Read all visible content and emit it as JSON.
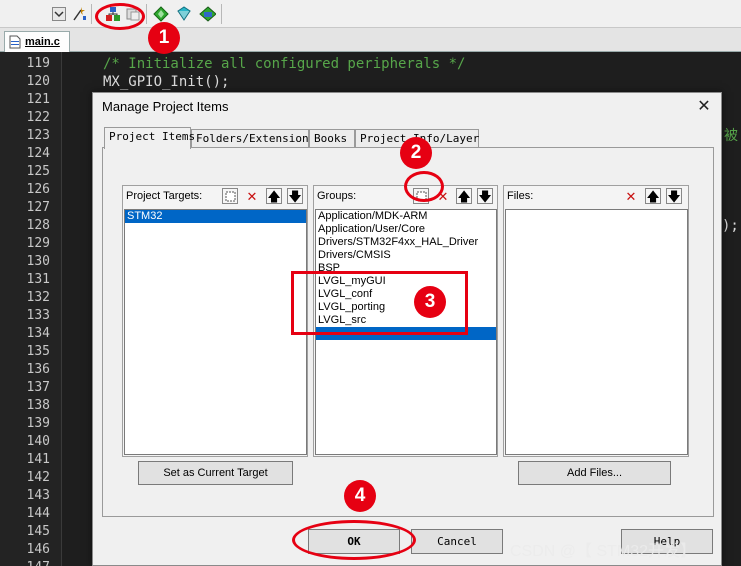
{
  "editor": {
    "tab_label": "main.c",
    "line_numbers": [
      "119",
      "120",
      "121",
      "122",
      "123",
      "124",
      "125",
      "126",
      "127",
      "128",
      "129",
      "130",
      "131",
      "132",
      "133",
      "134",
      "135",
      "136",
      "137",
      "138",
      "139",
      "140",
      "141",
      "142",
      "143",
      "144",
      "145",
      "146",
      "147"
    ],
    "code_line_119": "/* Initialize all configured peripherals */",
    "code_line_120": "MX_GPIO_Init();",
    "code_fragment_123": "被",
    "code_fragment_128": ");"
  },
  "dialog": {
    "title": "Manage Project Items",
    "close_glyph": "✕",
    "tabs": [
      "Project Items",
      "Folders/Extensions",
      "Books",
      "Project Info/Layer"
    ],
    "targets": {
      "label": "Project Targets:",
      "items": [
        {
          "label": "STM32",
          "selected": true
        }
      ],
      "button": "Set as Current Target"
    },
    "groups": {
      "label": "Groups:",
      "items": [
        {
          "label": "Application/MDK-ARM",
          "selected": false
        },
        {
          "label": "Application/User/Core",
          "selected": false
        },
        {
          "label": "Drivers/STM32F4xx_HAL_Driver",
          "selected": false
        },
        {
          "label": "Drivers/CMSIS",
          "selected": false
        },
        {
          "label": "BSP",
          "selected": false
        },
        {
          "label": "LVGL_myGUI",
          "selected": false
        },
        {
          "label": "LVGL_conf",
          "selected": false
        },
        {
          "label": "LVGL_porting",
          "selected": false
        },
        {
          "label": "LVGL_src",
          "selected": false
        },
        {
          "label": "",
          "selected": true
        }
      ]
    },
    "files": {
      "label": "Files:",
      "items": [],
      "button": "Add Files..."
    },
    "ok_label": "OK",
    "cancel_label": "Cancel",
    "help_label": "Help"
  },
  "annotations": [
    "1",
    "2",
    "3",
    "4"
  ],
  "watermark": "CSDN @【 STM32开发】",
  "colors": {
    "annotation_red": "#e60012",
    "selection_blue": "#0066c6",
    "editor_bg": "#1e1e1e",
    "comment_green": "#57a64a"
  }
}
